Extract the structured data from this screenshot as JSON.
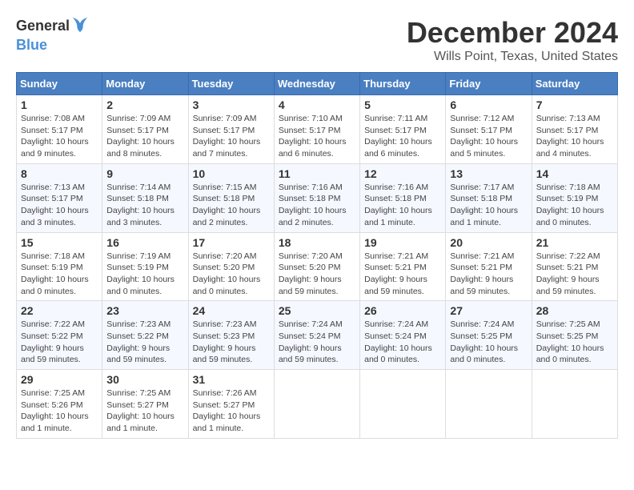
{
  "logo": {
    "general": "General",
    "blue": "Blue"
  },
  "header": {
    "month": "December 2024",
    "location": "Wills Point, Texas, United States"
  },
  "weekdays": [
    "Sunday",
    "Monday",
    "Tuesday",
    "Wednesday",
    "Thursday",
    "Friday",
    "Saturday"
  ],
  "weeks": [
    [
      {
        "day": "1",
        "sunrise": "7:08 AM",
        "sunset": "5:17 PM",
        "daylight": "10 hours and 9 minutes."
      },
      {
        "day": "2",
        "sunrise": "7:09 AM",
        "sunset": "5:17 PM",
        "daylight": "10 hours and 8 minutes."
      },
      {
        "day": "3",
        "sunrise": "7:09 AM",
        "sunset": "5:17 PM",
        "daylight": "10 hours and 7 minutes."
      },
      {
        "day": "4",
        "sunrise": "7:10 AM",
        "sunset": "5:17 PM",
        "daylight": "10 hours and 6 minutes."
      },
      {
        "day": "5",
        "sunrise": "7:11 AM",
        "sunset": "5:17 PM",
        "daylight": "10 hours and 6 minutes."
      },
      {
        "day": "6",
        "sunrise": "7:12 AM",
        "sunset": "5:17 PM",
        "daylight": "10 hours and 5 minutes."
      },
      {
        "day": "7",
        "sunrise": "7:13 AM",
        "sunset": "5:17 PM",
        "daylight": "10 hours and 4 minutes."
      }
    ],
    [
      {
        "day": "8",
        "sunrise": "7:13 AM",
        "sunset": "5:17 PM",
        "daylight": "10 hours and 3 minutes."
      },
      {
        "day": "9",
        "sunrise": "7:14 AM",
        "sunset": "5:18 PM",
        "daylight": "10 hours and 3 minutes."
      },
      {
        "day": "10",
        "sunrise": "7:15 AM",
        "sunset": "5:18 PM",
        "daylight": "10 hours and 2 minutes."
      },
      {
        "day": "11",
        "sunrise": "7:16 AM",
        "sunset": "5:18 PM",
        "daylight": "10 hours and 2 minutes."
      },
      {
        "day": "12",
        "sunrise": "7:16 AM",
        "sunset": "5:18 PM",
        "daylight": "10 hours and 1 minute."
      },
      {
        "day": "13",
        "sunrise": "7:17 AM",
        "sunset": "5:18 PM",
        "daylight": "10 hours and 1 minute."
      },
      {
        "day": "14",
        "sunrise": "7:18 AM",
        "sunset": "5:19 PM",
        "daylight": "10 hours and 0 minutes."
      }
    ],
    [
      {
        "day": "15",
        "sunrise": "7:18 AM",
        "sunset": "5:19 PM",
        "daylight": "10 hours and 0 minutes."
      },
      {
        "day": "16",
        "sunrise": "7:19 AM",
        "sunset": "5:19 PM",
        "daylight": "10 hours and 0 minutes."
      },
      {
        "day": "17",
        "sunrise": "7:20 AM",
        "sunset": "5:20 PM",
        "daylight": "10 hours and 0 minutes."
      },
      {
        "day": "18",
        "sunrise": "7:20 AM",
        "sunset": "5:20 PM",
        "daylight": "9 hours and 59 minutes."
      },
      {
        "day": "19",
        "sunrise": "7:21 AM",
        "sunset": "5:21 PM",
        "daylight": "9 hours and 59 minutes."
      },
      {
        "day": "20",
        "sunrise": "7:21 AM",
        "sunset": "5:21 PM",
        "daylight": "9 hours and 59 minutes."
      },
      {
        "day": "21",
        "sunrise": "7:22 AM",
        "sunset": "5:21 PM",
        "daylight": "9 hours and 59 minutes."
      }
    ],
    [
      {
        "day": "22",
        "sunrise": "7:22 AM",
        "sunset": "5:22 PM",
        "daylight": "9 hours and 59 minutes."
      },
      {
        "day": "23",
        "sunrise": "7:23 AM",
        "sunset": "5:22 PM",
        "daylight": "9 hours and 59 minutes."
      },
      {
        "day": "24",
        "sunrise": "7:23 AM",
        "sunset": "5:23 PM",
        "daylight": "9 hours and 59 minutes."
      },
      {
        "day": "25",
        "sunrise": "7:24 AM",
        "sunset": "5:24 PM",
        "daylight": "9 hours and 59 minutes."
      },
      {
        "day": "26",
        "sunrise": "7:24 AM",
        "sunset": "5:24 PM",
        "daylight": "10 hours and 0 minutes."
      },
      {
        "day": "27",
        "sunrise": "7:24 AM",
        "sunset": "5:25 PM",
        "daylight": "10 hours and 0 minutes."
      },
      {
        "day": "28",
        "sunrise": "7:25 AM",
        "sunset": "5:25 PM",
        "daylight": "10 hours and 0 minutes."
      }
    ],
    [
      {
        "day": "29",
        "sunrise": "7:25 AM",
        "sunset": "5:26 PM",
        "daylight": "10 hours and 1 minute."
      },
      {
        "day": "30",
        "sunrise": "7:25 AM",
        "sunset": "5:27 PM",
        "daylight": "10 hours and 1 minute."
      },
      {
        "day": "31",
        "sunrise": "7:26 AM",
        "sunset": "5:27 PM",
        "daylight": "10 hours and 1 minute."
      },
      null,
      null,
      null,
      null
    ]
  ],
  "labels": {
    "sunrise": "Sunrise:",
    "sunset": "Sunset:",
    "daylight": "Daylight:"
  }
}
